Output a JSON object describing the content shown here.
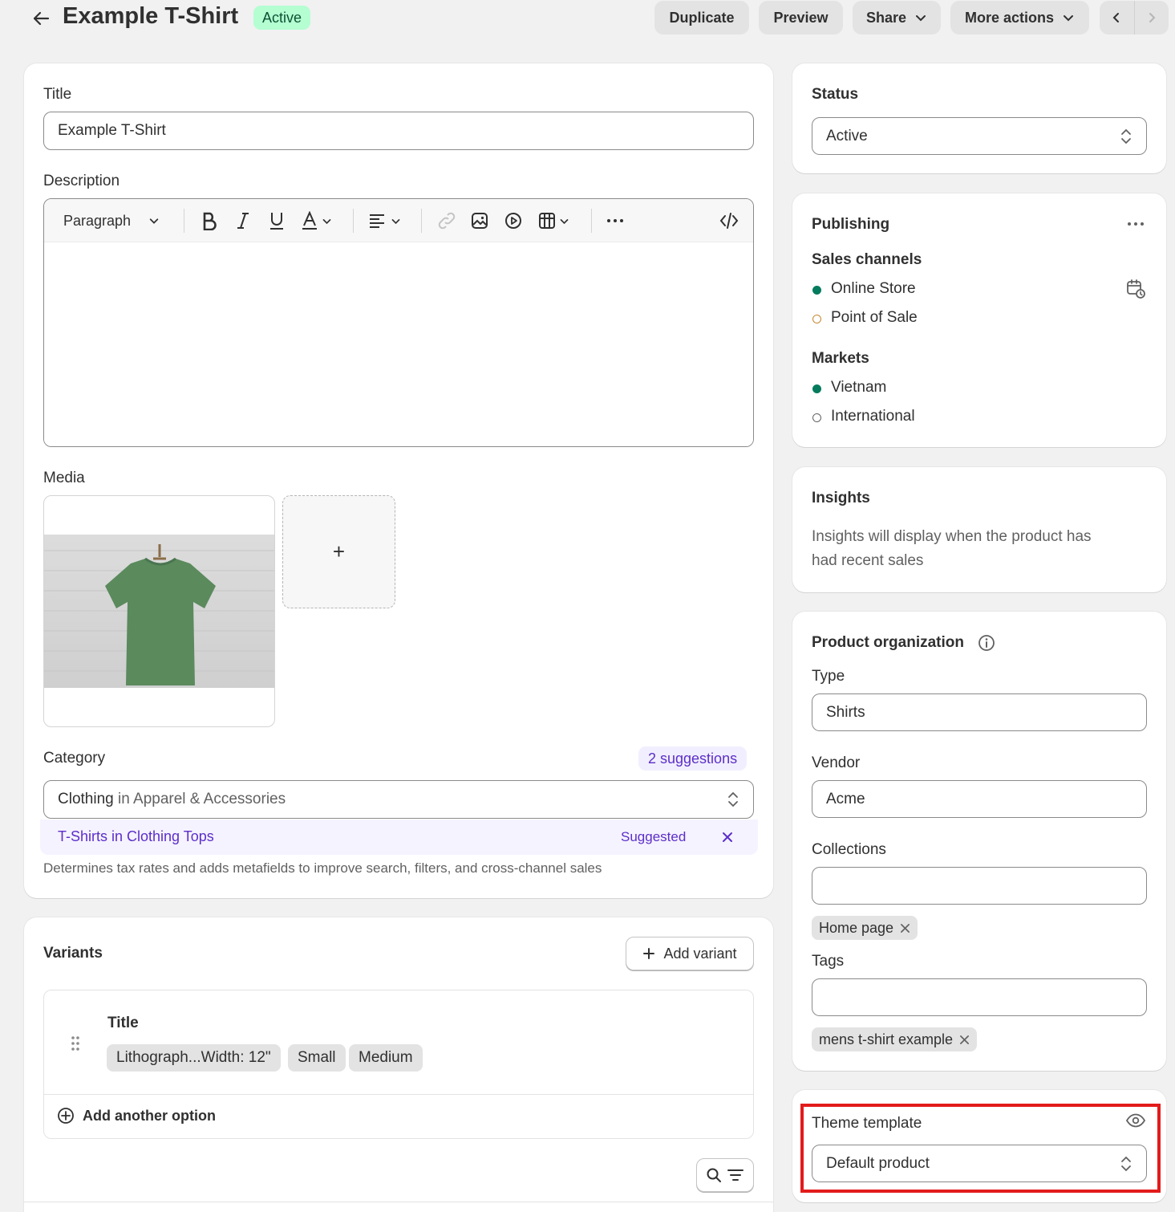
{
  "header": {
    "title": "Example T-Shirt",
    "status": "Active",
    "buttons": {
      "duplicate": "Duplicate",
      "preview": "Preview",
      "share": "Share",
      "more": "More actions"
    }
  },
  "main": {
    "title_label": "Title",
    "title_value": "Example T-Shirt",
    "description_label": "Description",
    "editor": {
      "format": "Paragraph"
    },
    "media_label": "Media",
    "media_add": "+",
    "category": {
      "label": "Category",
      "suggestions": "2 suggestions",
      "value_strong": "Clothing",
      "value_rest": " in Apparel & Accessories",
      "suggested_strong": "T-Shirts",
      "suggested_rest": " in Clothing Tops",
      "suggested_badge": "Suggested",
      "help": "Determines tax rates and adds metafields to improve search, filters, and cross-channel sales"
    }
  },
  "variants": {
    "heading": "Variants",
    "add_variant": "Add variant",
    "option_title": "Title",
    "values": [
      "Lithograph...Width: 12\"",
      "Small",
      "Medium"
    ],
    "add_option": "Add another option"
  },
  "sidebar": {
    "status": {
      "heading": "Status",
      "value": "Active"
    },
    "publishing": {
      "heading": "Publishing",
      "sales_channels_label": "Sales channels",
      "channels": [
        "Online Store",
        "Point of Sale"
      ],
      "markets_label": "Markets",
      "markets": [
        "Vietnam",
        "International"
      ]
    },
    "insights": {
      "heading": "Insights",
      "text_line1": "Insights will display when the product has",
      "text_line2": "had recent sales"
    },
    "organization": {
      "heading": "Product organization",
      "type_label": "Type",
      "type_value": "Shirts",
      "vendor_label": "Vendor",
      "vendor_value": "Acme",
      "collections_label": "Collections",
      "collection_tag": "Home page",
      "tags_label": "Tags",
      "tag": "mens t-shirt example"
    },
    "theme": {
      "heading": "Theme template",
      "value": "Default product"
    }
  },
  "colors": {
    "accent_purple": "#5c2ec9",
    "status_green": "#b4fed2",
    "dot_green": "#047b5d",
    "dot_orange": "#c4872f",
    "highlight_red": "#e31b1b"
  }
}
